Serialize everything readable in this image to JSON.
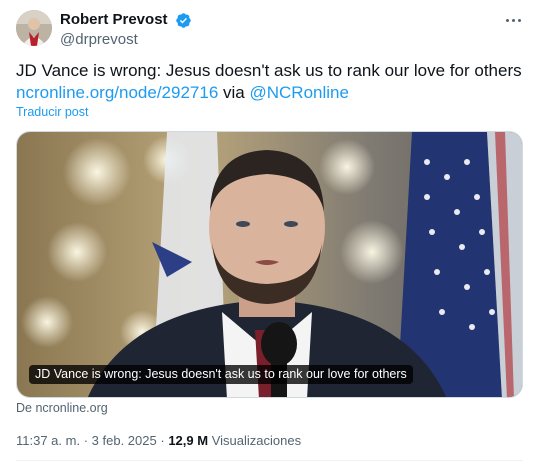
{
  "author": {
    "display_name": "Robert Prevost",
    "handle": "@drprevost",
    "verified": true
  },
  "tweet": {
    "text_line1": "JD Vance is wrong: Jesus doesn't ask us to rank our love for others",
    "link_url_text": "ncronline.org/node/292716",
    "via_word": "via",
    "mention": "@NCRonline",
    "translate_label": "Traducir post"
  },
  "media": {
    "caption": "JD Vance is wrong: Jesus doesn't ask us to rank our love for others",
    "source_label": "De ncronline.org"
  },
  "meta": {
    "time": "11:37 a. m.",
    "separator": "·",
    "date": "3 feb. 2025",
    "views_count": "12,9 M",
    "views_label": "Visualizaciones"
  },
  "icons": {
    "verified": "verified-badge-icon",
    "more": "more-options-icon"
  },
  "colors": {
    "accent": "#1d9bf0",
    "text": "#0f1419",
    "muted": "#536471"
  }
}
